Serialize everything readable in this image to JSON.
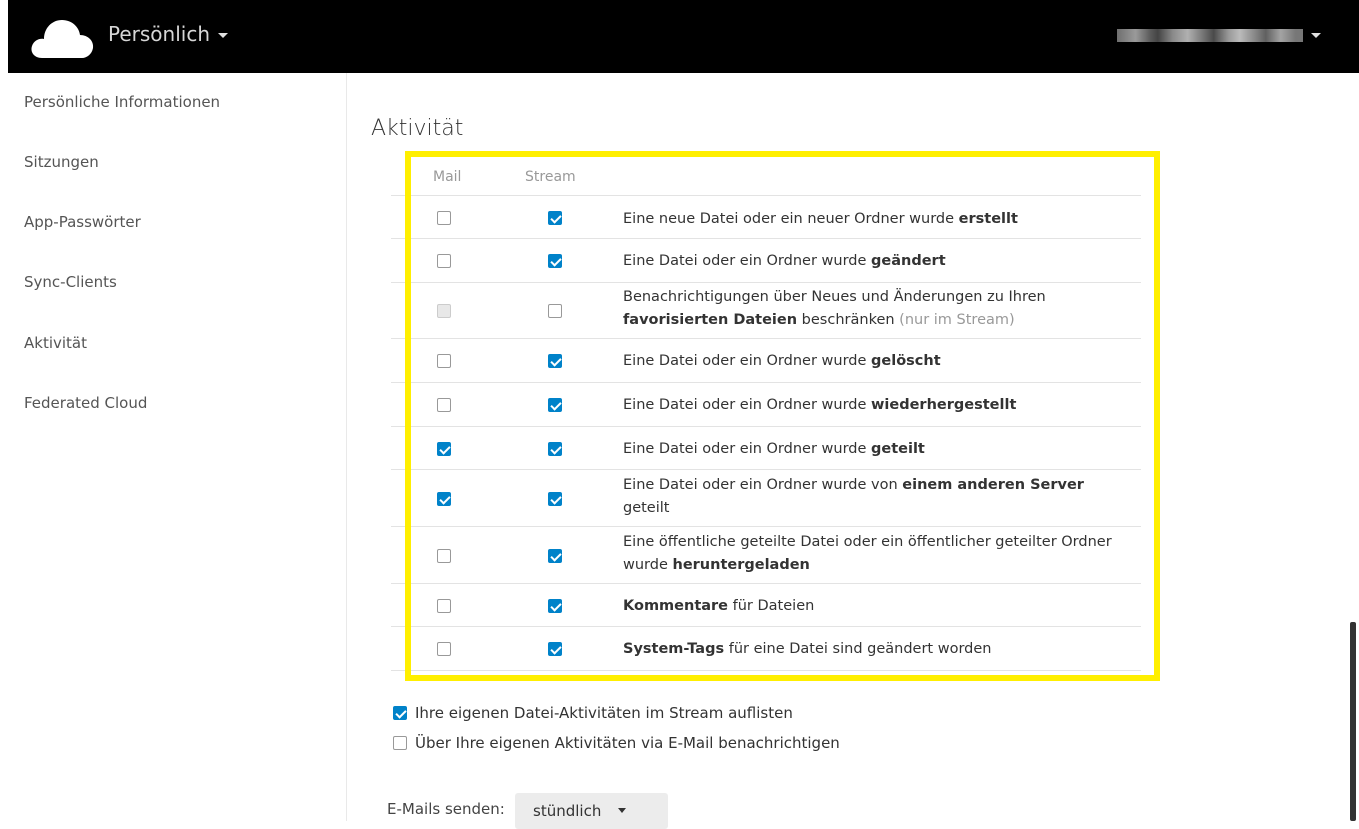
{
  "header": {
    "app_menu_label": "Persönlich",
    "user_name": ""
  },
  "sidebar": {
    "items": [
      {
        "label": "Persönliche Informationen"
      },
      {
        "label": "Sitzungen"
      },
      {
        "label": "App-Passwörter"
      },
      {
        "label": "Sync-Clients"
      },
      {
        "label": "Aktivität"
      },
      {
        "label": "Federated Cloud"
      }
    ]
  },
  "activity": {
    "title": "Aktivität",
    "col_mail": "Mail",
    "col_stream": "Stream",
    "rows": [
      {
        "pre": "Eine neue Datei oder ein neuer Ordner wurde ",
        "bold": "erstellt",
        "post": "",
        "mail": "unchecked",
        "stream": "checked"
      },
      {
        "pre": "Eine Datei oder ein Ordner wurde ",
        "bold": "geändert",
        "post": "",
        "mail": "unchecked",
        "stream": "checked"
      },
      {
        "pre": "Benachrichtigungen über Neues und Änderungen zu Ihren ",
        "bold": "favorisierten Dateien",
        "post": " beschränken ",
        "note": "(nur im Stream)",
        "mail": "disabled",
        "stream": "unchecked"
      },
      {
        "pre": "Eine Datei oder ein Ordner wurde ",
        "bold": "gelöscht",
        "post": "",
        "mail": "unchecked",
        "stream": "checked"
      },
      {
        "pre": "Eine Datei oder ein Ordner wurde ",
        "bold": "wiederhergestellt",
        "post": "",
        "mail": "unchecked",
        "stream": "checked"
      },
      {
        "pre": "Eine Datei oder ein Ordner wurde ",
        "bold": "geteilt",
        "post": "",
        "mail": "checked",
        "stream": "checked"
      },
      {
        "pre": "Eine Datei oder ein Ordner wurde von ",
        "bold": "einem anderen Server",
        "post": " geteilt",
        "mail": "checked",
        "stream": "checked"
      },
      {
        "pre": "Eine öffentliche geteilte Datei oder ein öffentlicher geteilter Ordner wurde ",
        "bold": "heruntergeladen",
        "post": "",
        "mail": "unchecked",
        "stream": "checked"
      },
      {
        "pre": "",
        "bold": "Kommentare",
        "post": " für Dateien",
        "mail": "unchecked",
        "stream": "checked"
      },
      {
        "pre": "",
        "bold": "System-Tags",
        "post": " für eine Datei sind geändert worden",
        "mail": "unchecked",
        "stream": "checked"
      }
    ],
    "option_own_stream": "Ihre eigenen Datei-Aktivitäten im Stream auflisten",
    "option_own_stream_checked": true,
    "option_own_mail": "Über Ihre eigenen Aktivitäten via E-Mail benachrichtigen",
    "option_own_mail_checked": false,
    "send_label": "E-Mails senden:",
    "send_value": "stündlich"
  },
  "colors": {
    "header_bg": "#000000",
    "accent": "#0082c9",
    "highlight": "#ffef00"
  }
}
